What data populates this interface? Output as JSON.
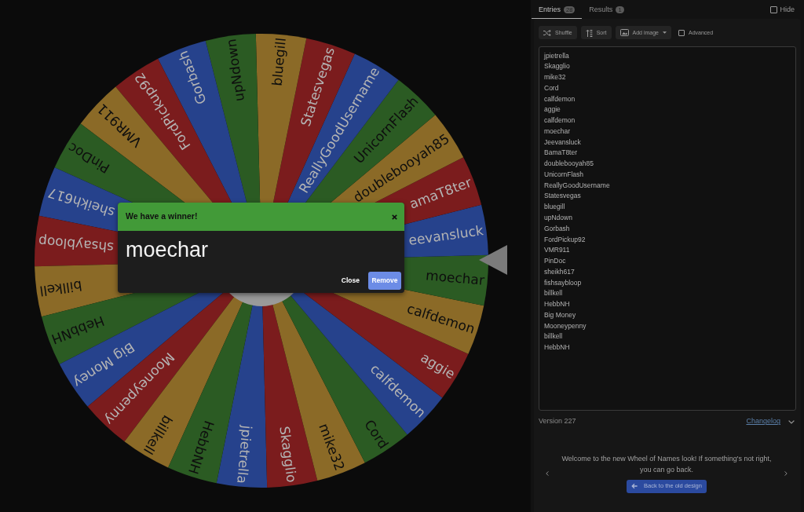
{
  "wheel": {
    "segments": [
      "jpietrella",
      "Skagglio",
      "mike32",
      "Cord",
      "calfdemon",
      "aggie",
      "calfdemon",
      "moechar",
      "eevansluck",
      "amaT8ter",
      "doublebooyah85",
      "UnicornFlash",
      "ReallyGoodUsername",
      "Statesvegas",
      "bluegill",
      "upNdown",
      "Gorbash",
      "FordPickup92",
      "VMR911",
      "PinDoc",
      "sheikh617",
      "shsaybloop",
      "billkell",
      "HebbNH",
      "Big Money",
      "Mooneypenny",
      "billkell",
      "HebbNH"
    ]
  },
  "winner_dialog": {
    "title": "We have a winner!",
    "winner": "moechar",
    "buttons": [
      {
        "label": "Close",
        "kind": "text"
      },
      {
        "label": "Remove",
        "kind": "primary"
      }
    ]
  },
  "sidebar": {
    "tabs": [
      {
        "label": "Entries",
        "count": "28",
        "selected": true
      },
      {
        "label": "Results",
        "count": "1",
        "selected": false
      }
    ],
    "hide": {
      "label": "Hide",
      "checked": false
    },
    "toolbar": {
      "buttons": [
        {
          "label": "Shuffle",
          "kind": "plain"
        },
        {
          "label": "Sort",
          "kind": "plain"
        },
        {
          "label": "Add image",
          "kind": "dropdown"
        }
      ],
      "advanced": {
        "label": "Advanced",
        "checked": false
      }
    },
    "entries": [
      "jpietrella",
      "Skagglio",
      "mike32",
      "Cord",
      "calfdemon",
      "aggie",
      "calfdemon",
      "moechar",
      "Jeevansluck",
      "BamaT8ter",
      "doublebooyah85",
      "UnicornFlash",
      "ReallyGoodUsername",
      "Statesvegas",
      "bluegill",
      "upNdown",
      "Gorbash",
      "FordPickup92",
      "VMR911",
      "PinDoc",
      "sheikh617",
      "fishsaybloop",
      "billkell",
      "HebbNH",
      "Big Money",
      "Mooneypenny",
      "billkell",
      "HebbNH"
    ],
    "version": "Version 227",
    "changelog": "Changelog",
    "announcement": {
      "text": "Welcome to the new Wheel of Names look! If something's not right, you can go back.",
      "button": "Back to the old design"
    }
  }
}
